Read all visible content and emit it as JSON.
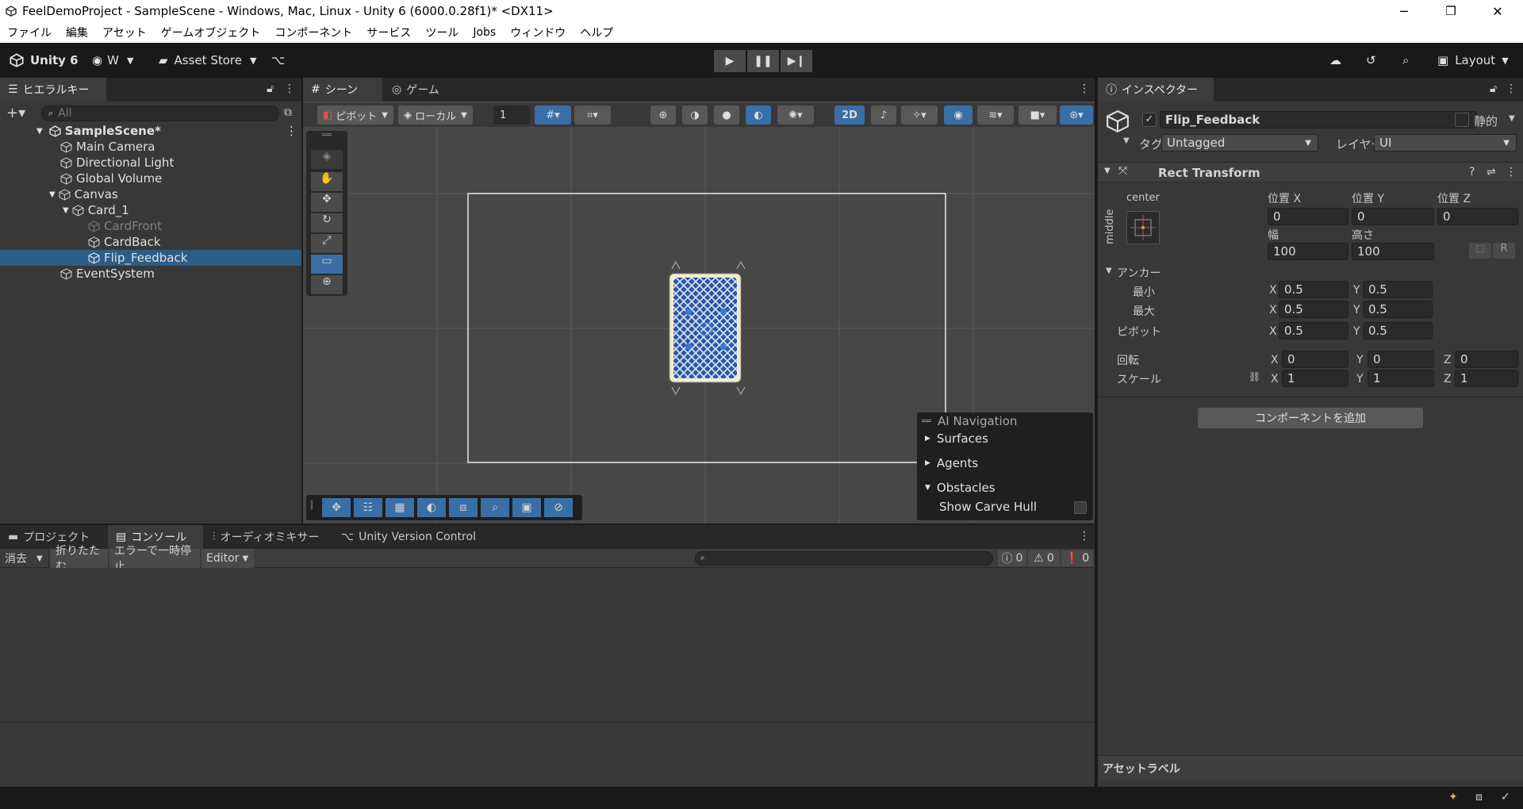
{
  "window": {
    "title": "FeelDemoProject - SampleScene - Windows, Mac, Linux - Unity 6 (6000.0.28f1)* <DX11>",
    "minimize": "─",
    "maximize": "❐",
    "close": "✕"
  },
  "menu": [
    "ファイル",
    "編集",
    "アセット",
    "ゲームオブジェクト",
    "コンポーネント",
    "サービス",
    "ツール",
    "Jobs",
    "ウィンドウ",
    "ヘルプ"
  ],
  "toolbar": {
    "unity_label": "Unity 6",
    "account": "W",
    "asset_store": "Asset Store",
    "layout": "Layout"
  },
  "hierarchy": {
    "tab": "ヒエラルキー",
    "search_placeholder": "All",
    "items": [
      {
        "label": "SampleScene*"
      },
      {
        "label": "Main Camera"
      },
      {
        "label": "Directional Light"
      },
      {
        "label": "Global Volume"
      },
      {
        "label": "Canvas"
      },
      {
        "label": "Card_1"
      },
      {
        "label": "CardFront"
      },
      {
        "label": "CardBack"
      },
      {
        "label": "Flip_Feedback"
      },
      {
        "label": "EventSystem"
      }
    ]
  },
  "scene": {
    "tab_scene": "シーン",
    "tab_game": "ゲーム",
    "pivot": "ピボット",
    "local": "ローカル",
    "grid_value": "1",
    "mode_2d": "2D",
    "overlay_title": "AI Navigation",
    "overlay_items": [
      "Surfaces",
      "Agents",
      "Obstacles"
    ],
    "show_carve_hull": "Show Carve Hull"
  },
  "inspector": {
    "tab": "インスペクター",
    "object_name": "Flip_Feedback",
    "static_label": "静的",
    "tag_label": "タグ",
    "tag_value": "Untagged",
    "layer_label": "レイヤー",
    "layer_value": "UI",
    "component": "Rect Transform",
    "anchor_h": "center",
    "anchor_v": "middle",
    "pos_x_label": "位置 X",
    "pos_y_label": "位置 Y",
    "pos_z_label": "位置 Z",
    "pos_x": "0",
    "pos_y": "0",
    "pos_z": "0",
    "width_label": "幅",
    "height_label": "高さ",
    "width": "100",
    "height": "100",
    "r_button": "R",
    "anchors_label": "アンカー",
    "min_label": "最小",
    "max_label": "最大",
    "pivot_label": "ピボット",
    "rotation_label": "回転",
    "scale_label": "スケール",
    "x": "X",
    "y": "Y",
    "z": "Z",
    "min_x": "0.5",
    "min_y": "0.5",
    "max_x": "0.5",
    "max_y": "0.5",
    "pivot_x": "0.5",
    "pivot_y": "0.5",
    "rot_x": "0",
    "rot_y": "0",
    "rot_z": "0",
    "scale_x": "1",
    "scale_y": "1",
    "scale_z": "1",
    "add_component": "コンポーネントを追加",
    "asset_labels": "アセットラベル"
  },
  "console": {
    "tab_project": "プロジェクト",
    "tab_console": "コンソール",
    "tab_audio": "オーディオミキサー",
    "tab_vcs": "Unity Version Control",
    "clear": "消去",
    "collapse": "折りたたむ",
    "error_pause": "エラーで一時停止",
    "editor": "Editor",
    "count_log": "0",
    "count_warn": "0",
    "count_error": "0"
  },
  "colors": {
    "selection": "#2c5d87",
    "toggle_blue": "#3a6ea5",
    "card_blue": "#2d5aa8"
  }
}
